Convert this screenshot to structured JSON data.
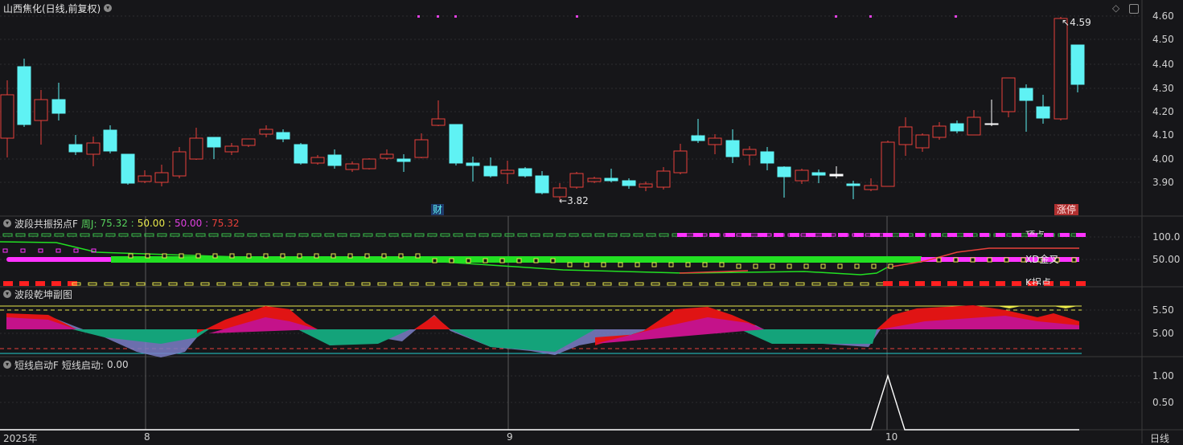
{
  "main": {
    "title": "山西焦化(日线,前复权)",
    "menu_icon": "chevron-down-icon",
    "price_ticks": [
      "4.60",
      "4.50",
      "4.40",
      "4.30",
      "4.20",
      "4.10",
      "4.00",
      "3.90"
    ],
    "high_label": "4.59",
    "low_label": "3.82",
    "marker_cai": "财",
    "marker_zhangting": "涨停",
    "colors": {
      "up": "#e8403a",
      "down": "#5ff2f4",
      "magenta": "#e040e0",
      "bg": "#161619",
      "grid": "#3a3a3a"
    }
  },
  "panel1": {
    "name": "波段共振拐点F",
    "label_j": "周J: ",
    "value_1": "75.32",
    "sep_1": " : ",
    "value_2": "50.00",
    "sep_2": " : ",
    "value_3": "50.00",
    "sep_3": " : ",
    "value_4": "75.32",
    "ticks": [
      "100.0",
      "50.00"
    ],
    "tag_xd": "XD金叉",
    "tag_k": "K拐点",
    "tag_top": "顶点"
  },
  "panel2": {
    "name": "波段乾坤副图",
    "ticks": [
      "5.50",
      "5.00"
    ]
  },
  "panel3": {
    "name": "短线启动F",
    "label": "短线启动: ",
    "value": "0.00",
    "ticks": [
      "1.00",
      "0.50"
    ]
  },
  "xaxis": {
    "labels": [
      "2025年",
      "8",
      "9",
      "10"
    ],
    "period": "日线"
  }
}
